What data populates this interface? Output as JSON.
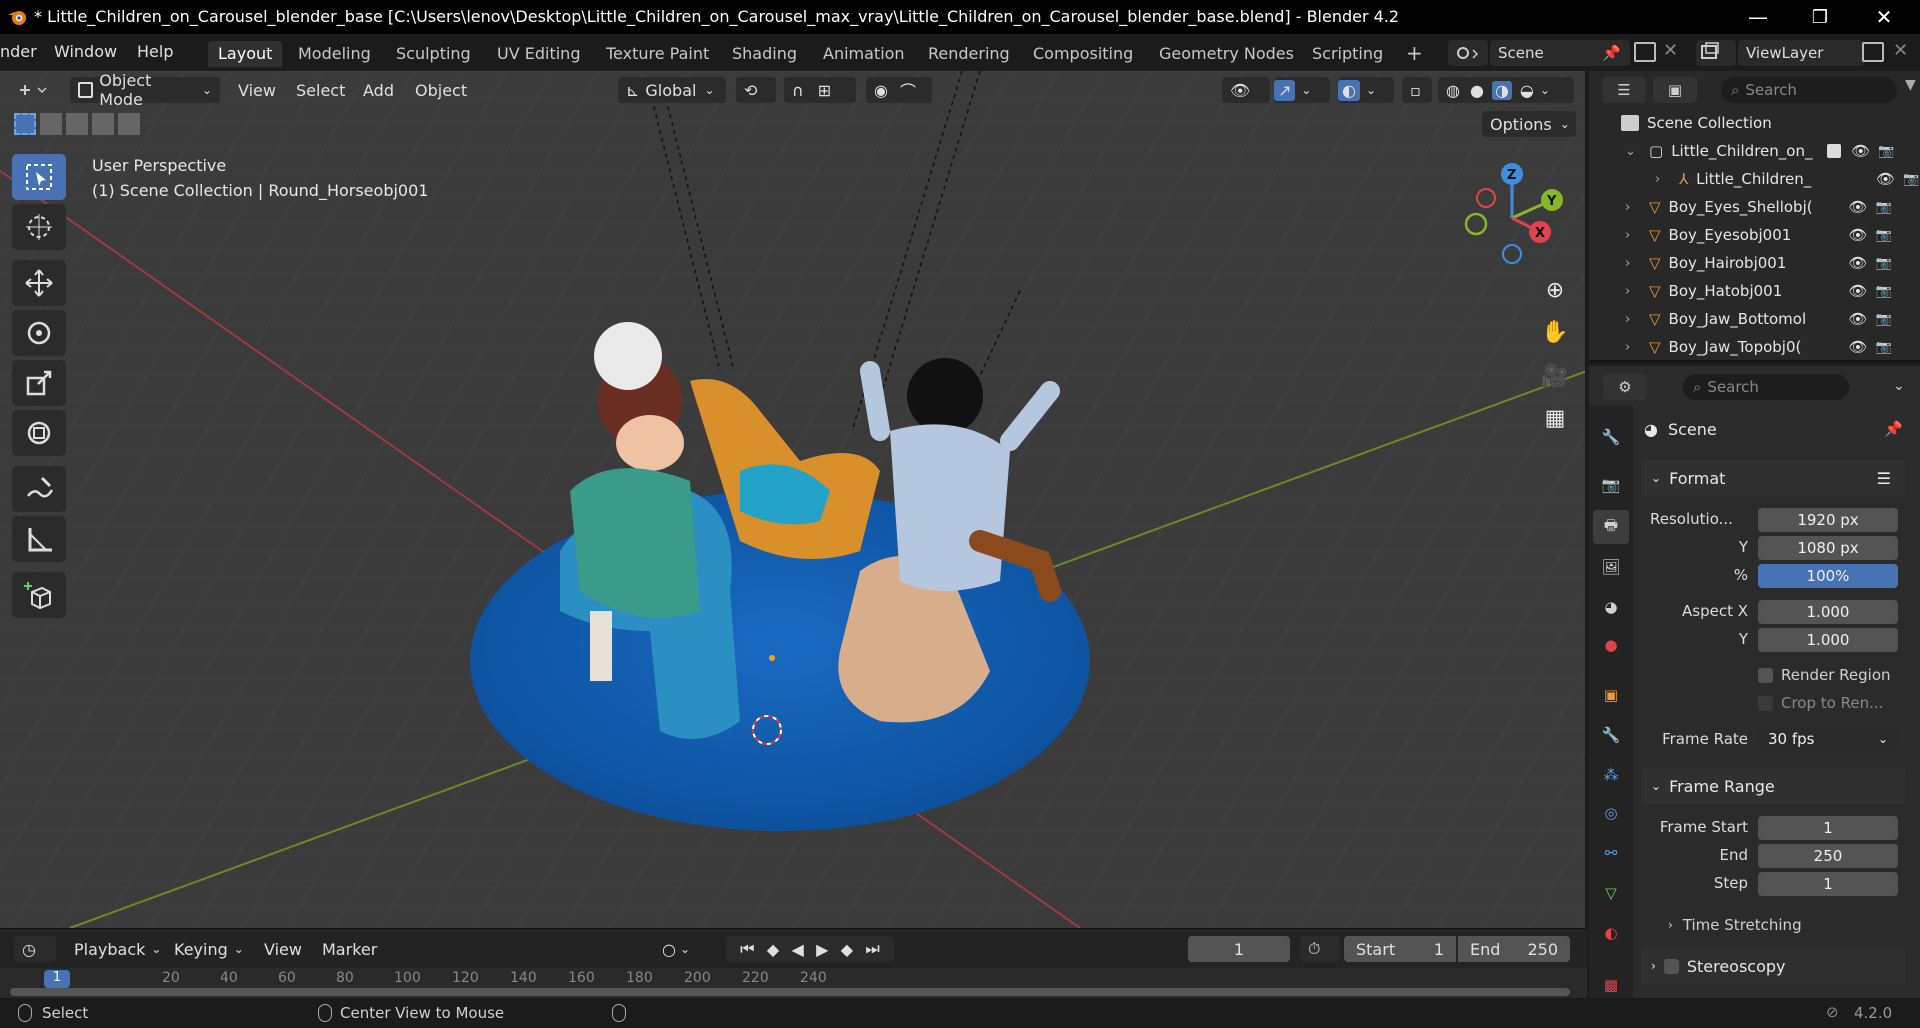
{
  "titlebar": {
    "title": "* Little_Children_on_Carousel_blender_base [C:\\Users\\lenov\\Desktop\\Little_Children_on_Carousel_max_vray\\Little_Children_on_Carousel_blender_base.blend] - Blender 4.2",
    "minimize": "—",
    "restore": "❐",
    "close": "✕"
  },
  "menus": [
    "nder",
    "Window",
    "Help"
  ],
  "workspaces": [
    "Layout",
    "Modeling",
    "Sculpting",
    "UV Editing",
    "Texture Paint",
    "Shading",
    "Animation",
    "Rendering",
    "Compositing",
    "Geometry Nodes",
    "Scripting"
  ],
  "workspace_add": "+",
  "scene": {
    "name": "Scene",
    "viewlayer": "ViewLayer"
  },
  "viewport_header": {
    "mode": "Object Mode",
    "menus": [
      "View",
      "Select",
      "Add",
      "Object"
    ],
    "orientation": "Global",
    "options": "Options"
  },
  "viewport": {
    "perspective": "User Perspective",
    "collection_info": "(1) Scene Collection | Round_Horseobj001",
    "gizmo": {
      "x": "X",
      "y": "Y",
      "z": "Z"
    }
  },
  "outliner": {
    "search_placeholder": "Search",
    "root": "Scene Collection",
    "items": [
      {
        "label": "Little_Children_on_",
        "kind": "collection"
      },
      {
        "label": "Little_Children_",
        "kind": "armature"
      },
      {
        "label": "Boy_Eyes_Shellobj(",
        "kind": "mesh"
      },
      {
        "label": "Boy_Eyesobj001",
        "kind": "mesh"
      },
      {
        "label": "Boy_Hairobj001",
        "kind": "mesh"
      },
      {
        "label": "Boy_Hatobj001",
        "kind": "mesh"
      },
      {
        "label": "Boy_Jaw_Bottomol",
        "kind": "mesh"
      },
      {
        "label": "Boy_Jaw_Topobj0(",
        "kind": "mesh"
      }
    ]
  },
  "properties": {
    "search_placeholder": "Search",
    "context": "Scene",
    "format": {
      "title": "Format",
      "res_label": "Resolutio...",
      "res_x": "1920 px",
      "res_y_label": "Y",
      "res_y": "1080 px",
      "pct_label": "%",
      "pct": "100%",
      "aspect_label": "Aspect X",
      "aspect_x": "1.000",
      "aspect_y_label": "Y",
      "aspect_y": "1.000",
      "render_region": "Render Region",
      "crop": "Crop to Ren...",
      "frame_rate_label": "Frame Rate",
      "frame_rate": "30 fps"
    },
    "frame_range": {
      "title": "Frame Range",
      "start_label": "Frame Start",
      "start": "1",
      "end_label": "End",
      "end": "250",
      "step_label": "Step",
      "step": "1"
    },
    "time_stretching": "Time Stretching",
    "stereoscopy": "Stereoscopy"
  },
  "timeline": {
    "menus": [
      "Playback",
      "Keying",
      "View",
      "Marker"
    ],
    "current_frame": "1",
    "start_label": "Start",
    "start": "1",
    "end_label": "End",
    "end": "250",
    "ticks": [
      "20",
      "40",
      "60",
      "80",
      "100",
      "120",
      "140",
      "160",
      "180",
      "200",
      "220",
      "240"
    ],
    "playhead": "1"
  },
  "statusbar": {
    "select": "Select",
    "center": "Center View to Mouse",
    "version": "4.2.0"
  },
  "colors": {
    "accent": "#4772b3",
    "x_axis": "#e0434d",
    "y_axis": "#86b825",
    "z_axis": "#3d8ee0"
  }
}
